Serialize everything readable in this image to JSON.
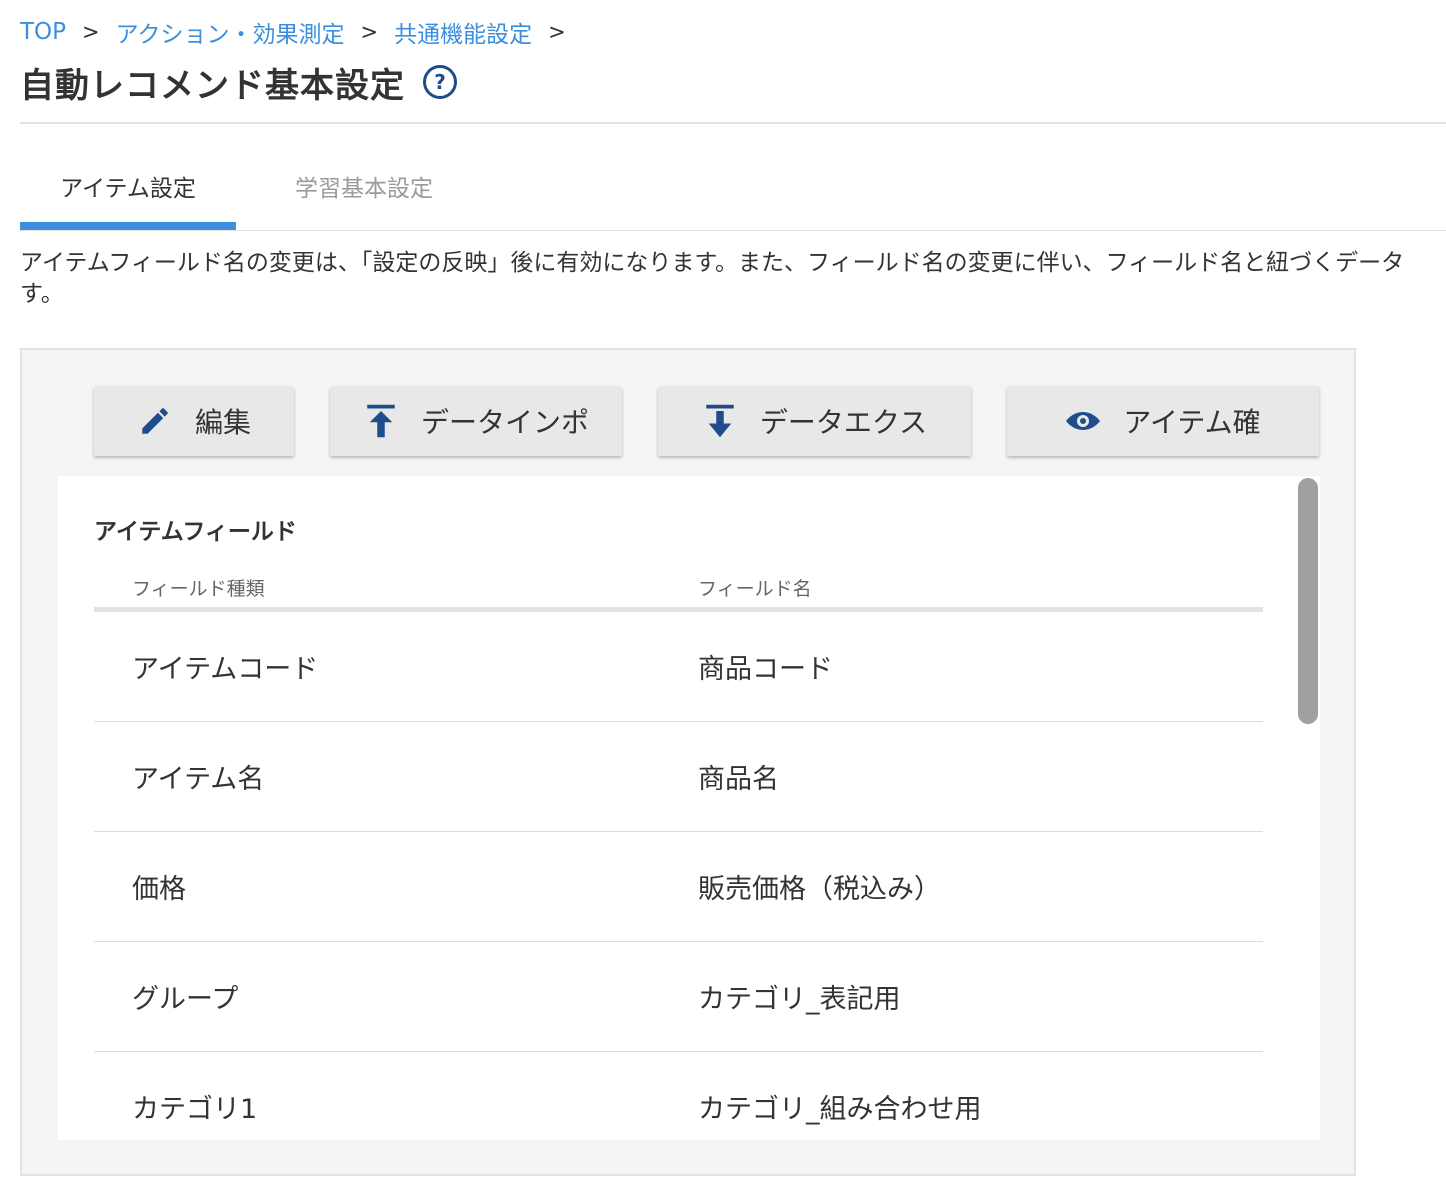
{
  "breadcrumb": {
    "items": [
      "TOP",
      "アクション・効果測定",
      "共通機能設定"
    ],
    "separator": ">"
  },
  "page": {
    "title": "自動レコメンド基本設定",
    "help_glyph": "?"
  },
  "tabs": [
    {
      "label": "アイテム設定",
      "active": true
    },
    {
      "label": "学習基本設定",
      "active": false
    }
  ],
  "notice": {
    "line1": "アイテムフィールド名の変更は、「設定の反映」後に有効になります。また、フィールド名の変更に伴い、フィールド名と紐づくデータ",
    "line2": "す。"
  },
  "toolbar": {
    "edit_label": "編集",
    "import_label": "データインポ",
    "export_label": "データエクス",
    "confirm_label": "アイテム確"
  },
  "item_fields": {
    "title": "アイテムフィールド",
    "columns": [
      "フィールド種類",
      "フィールド名"
    ],
    "rows": [
      {
        "type": "アイテムコード",
        "name": "商品コード"
      },
      {
        "type": "アイテム名",
        "name": "商品名"
      },
      {
        "type": "価格",
        "name": "販売価格（税込み）"
      },
      {
        "type": "グループ",
        "name": "カテゴリ_表記用"
      },
      {
        "type": "カテゴリ1",
        "name": "カテゴリ_組み合わせ用"
      }
    ]
  },
  "colors": {
    "link": "#3b8fde",
    "accent": "#3b8fde",
    "icon": "#1f4d8c",
    "button_bg": "#e8e8e8"
  }
}
